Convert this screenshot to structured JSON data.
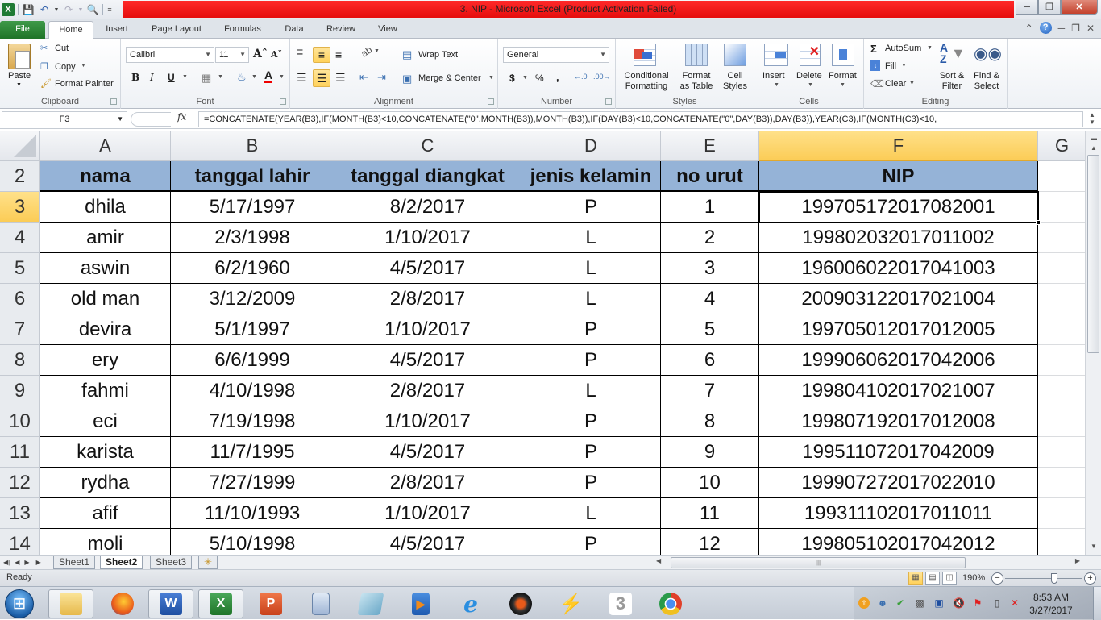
{
  "window": {
    "title": "3. NIP  -  Microsoft Excel (Product Activation Failed)"
  },
  "ribbon_tabs": [
    "File",
    "Home",
    "Insert",
    "Page Layout",
    "Formulas",
    "Data",
    "Review",
    "View"
  ],
  "ribbon": {
    "clipboard": {
      "label": "Clipboard",
      "paste": "Paste",
      "cut": "Cut",
      "copy": "Copy",
      "format_painter": "Format Painter"
    },
    "font": {
      "label": "Font",
      "font_name": "Calibri",
      "font_size": "11",
      "bold": "B",
      "italic": "I",
      "underline": "U"
    },
    "alignment": {
      "label": "Alignment",
      "wrap_text": "Wrap Text",
      "merge_center": "Merge & Center"
    },
    "number": {
      "label": "Number",
      "format": "General",
      "currency": "$",
      "percent": "%",
      "comma": ","
    },
    "styles": {
      "label": "Styles",
      "conditional_1": "Conditional",
      "conditional_2": "Formatting",
      "format_table_1": "Format",
      "format_table_2": "as Table",
      "cell_styles_1": "Cell",
      "cell_styles_2": "Styles"
    },
    "cells": {
      "label": "Cells",
      "insert": "Insert",
      "delete": "Delete",
      "format": "Format"
    },
    "editing": {
      "label": "Editing",
      "autosum": "AutoSum",
      "fill": "Fill",
      "clear": "Clear",
      "sort_1": "Sort &",
      "sort_2": "Filter",
      "find_1": "Find &",
      "find_2": "Select"
    }
  },
  "formula_bar": {
    "name_box": "F3",
    "fx": "fx",
    "formula": "=CONCATENATE(YEAR(B3),IF(MONTH(B3)<10,CONCATENATE(\"0\",MONTH(B3)),MONTH(B3)),IF(DAY(B3)<10,CONCATENATE(\"0\",DAY(B3)),DAY(B3)),YEAR(C3),IF(MONTH(C3)<10,"
  },
  "sheet": {
    "columns": [
      "A",
      "B",
      "C",
      "D",
      "E",
      "F",
      "G"
    ],
    "active_column": "F",
    "active_row": "3",
    "header_row": {
      "row": "2",
      "cells": [
        "nama",
        "tanggal lahir",
        "tanggal diangkat",
        "jenis kelamin",
        "no urut",
        "NIP"
      ]
    },
    "rows": [
      {
        "row": "3",
        "cells": [
          "dhila",
          "5/17/1997",
          "8/2/2017",
          "P",
          "1",
          "199705172017082001"
        ]
      },
      {
        "row": "4",
        "cells": [
          "amir",
          "2/3/1998",
          "1/10/2017",
          "L",
          "2",
          "199802032017011002"
        ]
      },
      {
        "row": "5",
        "cells": [
          "aswin",
          "6/2/1960",
          "4/5/2017",
          "L",
          "3",
          "196006022017041003"
        ]
      },
      {
        "row": "6",
        "cells": [
          "old man",
          "3/12/2009",
          "2/8/2017",
          "L",
          "4",
          "200903122017021004"
        ]
      },
      {
        "row": "7",
        "cells": [
          "devira",
          "5/1/1997",
          "1/10/2017",
          "P",
          "5",
          "199705012017012005"
        ]
      },
      {
        "row": "8",
        "cells": [
          "ery",
          "6/6/1999",
          "4/5/2017",
          "P",
          "6",
          "199906062017042006"
        ]
      },
      {
        "row": "9",
        "cells": [
          "fahmi",
          "4/10/1998",
          "2/8/2017",
          "L",
          "7",
          "199804102017021007"
        ]
      },
      {
        "row": "10",
        "cells": [
          "eci",
          "7/19/1998",
          "1/10/2017",
          "P",
          "8",
          "199807192017012008"
        ]
      },
      {
        "row": "11",
        "cells": [
          "karista",
          "11/7/1995",
          "4/5/2017",
          "P",
          "9",
          "199511072017042009"
        ]
      },
      {
        "row": "12",
        "cells": [
          "rydha",
          "7/27/1999",
          "2/8/2017",
          "P",
          "10",
          "199907272017022010"
        ]
      },
      {
        "row": "13",
        "cells": [
          "afif",
          "11/10/1993",
          "1/10/2017",
          "L",
          "11",
          "199311102017011011"
        ]
      },
      {
        "row": "14",
        "cells": [
          "moli",
          "5/10/1998",
          "4/5/2017",
          "P",
          "12",
          "199805102017042012"
        ]
      }
    ],
    "header_fill": "#95b3d7"
  },
  "sheet_tabs": [
    {
      "label": "Sheet1",
      "active": false
    },
    {
      "label": "Sheet2",
      "active": true
    },
    {
      "label": "Sheet3",
      "active": false
    }
  ],
  "status": {
    "text": "Ready",
    "zoom": "190%"
  },
  "taskbar": {
    "apps": [
      "windows-explorer",
      "firefox",
      "word",
      "excel",
      "powerpoint",
      "calculator",
      "notepad",
      "media-player",
      "internet-explorer",
      "system-tool",
      "winamp",
      "three-modem",
      "chrome"
    ],
    "time": "8:53 AM",
    "date": "3/27/2017"
  }
}
